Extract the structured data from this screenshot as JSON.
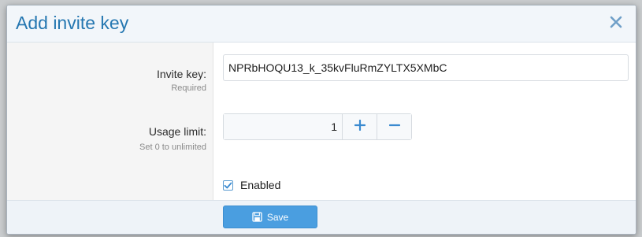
{
  "dialog": {
    "title": "Add invite key",
    "close_icon": "close-icon"
  },
  "fields": {
    "invite_key": {
      "label": "Invite key:",
      "hint": "Required",
      "value": "NPRbHOQU13_k_35kvFluRmZYLTX5XMbC"
    },
    "usage_limit": {
      "label": "Usage limit:",
      "hint": "Set 0 to unlimited",
      "value": "1",
      "increment_icon": "plus-icon",
      "decrement_icon": "minus-icon"
    },
    "enabled": {
      "label": "Enabled",
      "checked": true
    }
  },
  "footer": {
    "save_label": "Save",
    "save_icon": "save-icon"
  },
  "colors": {
    "accent": "#2577b1",
    "button": "#4a9ee0"
  }
}
